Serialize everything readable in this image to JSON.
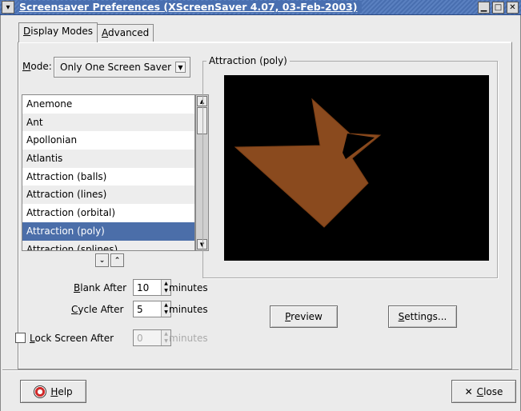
{
  "window": {
    "title": "Screensaver Preferences  (XScreenSaver 4.07, 03-Feb-2003)",
    "menu_glyph": "▾",
    "minimize_glyph": "▁",
    "maximize_glyph": "□",
    "close_glyph": "✕"
  },
  "tabs": [
    {
      "label_pre": "",
      "label_key": "D",
      "label_post": "isplay Modes",
      "active": true
    },
    {
      "label_pre": "",
      "label_key": "A",
      "label_post": "dvanced",
      "active": false
    }
  ],
  "mode": {
    "label_key": "M",
    "label_post": "ode:",
    "selected": "Only One Screen Saver"
  },
  "screensavers": [
    "Anemone",
    "Ant",
    "Apollonian",
    "Atlantis",
    "Attraction (balls)",
    "Attraction (lines)",
    "Attraction (orbital)",
    "Attraction (poly)",
    "Attraction (splines)"
  ],
  "selected_index": 7,
  "blank_after": {
    "key": "B",
    "rest": "lank After",
    "value": "10",
    "unit": "minutes"
  },
  "cycle_after": {
    "key": "C",
    "rest": "ycle After",
    "value": "5",
    "unit": "minutes"
  },
  "lock_screen": {
    "key": "L",
    "rest": "ock Screen After",
    "value": "0",
    "unit": "minutes",
    "checked": false
  },
  "preview": {
    "frame_label": "Attraction (poly)",
    "button_key": "P",
    "button_rest": "review",
    "shape_color": "#8a4a1e"
  },
  "settings_button": {
    "key": "S",
    "rest": "ettings..."
  },
  "help_button": {
    "key": "H",
    "rest": "elp"
  },
  "close_button": {
    "key": "C",
    "rest": "lose",
    "icon": "✕"
  }
}
